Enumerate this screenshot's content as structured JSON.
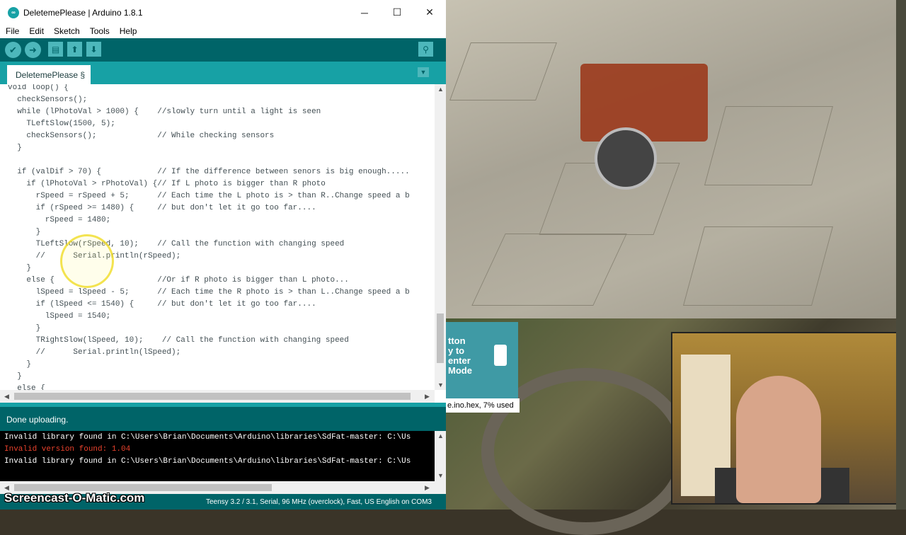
{
  "window": {
    "title": "DeletemePlease | Arduino 1.8.1",
    "minimize": "─",
    "maximize": "☐",
    "close": "✕"
  },
  "menu": [
    "File",
    "Edit",
    "Sketch",
    "Tools",
    "Help"
  ],
  "toolbar": {
    "verify_icon": "check-icon",
    "upload_icon": "arrow-right-icon",
    "new_icon": "new-file-icon",
    "open_icon": "open-icon",
    "save_icon": "save-icon",
    "serial_icon": "magnifier-icon"
  },
  "tab": {
    "label": "DeletemePlease §"
  },
  "code": [
    "void loop() {",
    "  checkSensors();",
    "  while (lPhotoVal > 1000) {    //slowly turn until a light is seen",
    "    TLeftSlow(1500, 5);",
    "    checkSensors();             // While checking sensors",
    "  }",
    "",
    "  if (valDif > 70) {            // If the difference between senors is big enough.....",
    "    if (lPhotoVal > rPhotoVal) {// If L photo is bigger than R photo",
    "      rSpeed = rSpeed + 5;      // Each time the L photo is > than R..Change speed a b",
    "      if (rSpeed >= 1480) {     // but don't let it go too far....",
    "        rSpeed = 1480;",
    "      }",
    "      TLeftSlow(rSpeed, 10);    // Call the function with changing speed",
    "      //      Serial.println(rSpeed);",
    "    }",
    "    else {                      //Or if R photo is bigger than L photo...",
    "      lSpeed = lSpeed - 5;      // Each time the R photo is > than L..Change speed a b",
    "      if (lSpeed <= 1540) {     // but don't let it go too far....",
    "        lSpeed = 1540;",
    "      }",
    "      TRightSlow(lSpeed, 10);    // Call the function with changing speed",
    "      //      Serial.println(lSpeed);",
    "    }",
    "  }",
    "  else {"
  ],
  "status": "Done uploading.",
  "console": [
    {
      "text": "Invalid library found in C:\\Users\\Brian\\Documents\\Arduino\\libraries\\SdFat-master: C:\\Us",
      "color": "#ffffff"
    },
    {
      "text": "Invalid version found: 1.04",
      "color": "#e8412c"
    },
    {
      "text": "Invalid library found in C:\\Users\\Brian\\Documents\\Arduino\\libraries\\SdFat-master: C:\\Us",
      "color": "#ffffff"
    }
  ],
  "footer": "Teensy 3.2 / 3.1, Serial, 96 MHz (overclock), Fast, US English on COM3",
  "watermark": "Screencast-O-Matic.com",
  "teensy_loader": {
    "hint_lines": [
      "tton",
      "y to",
      "enter",
      "Mode"
    ],
    "file_status": "e.ino.hex, 7% used"
  }
}
